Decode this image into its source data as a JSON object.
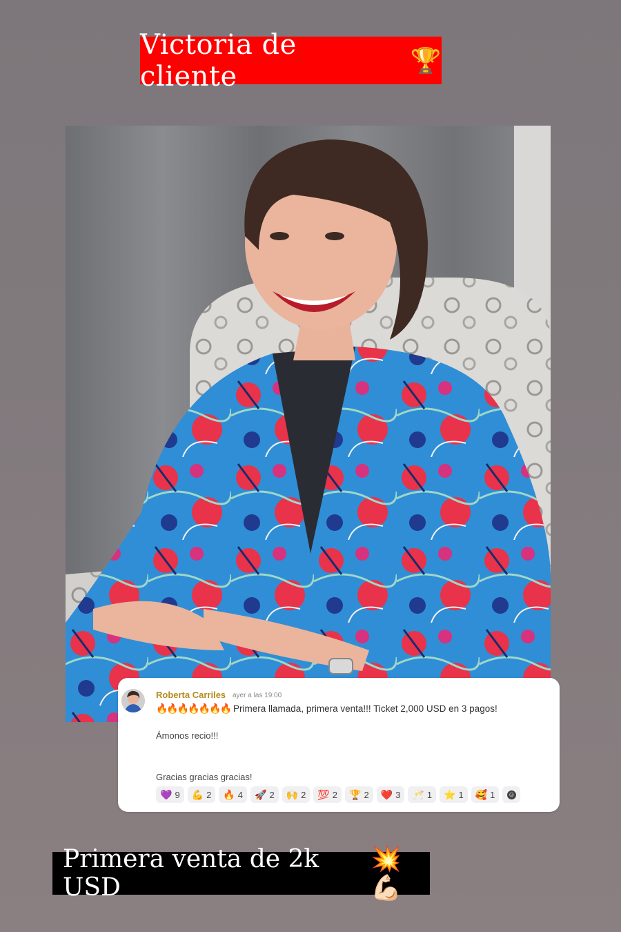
{
  "top_banner": {
    "text": "Victoria de cliente",
    "emoji": "🏆"
  },
  "comment": {
    "author": "Roberta Carriles",
    "timestamp": "ayer a las 19:00",
    "fires": "🔥🔥🔥🔥🔥🔥🔥",
    "line1": "Primera llamada, primera venta!!! Ticket 2,000 USD en 3 pagos!",
    "line2": "Ámonos recio!!!",
    "line3": "Gracias gracias gracias!",
    "reactions": [
      {
        "emoji": "💜",
        "count": "9"
      },
      {
        "emoji": "💪",
        "count": "2"
      },
      {
        "emoji": "🔥",
        "count": "4"
      },
      {
        "emoji": "🚀",
        "count": "2"
      },
      {
        "emoji": "🙌",
        "count": "2"
      },
      {
        "emoji": "💯",
        "count": "2"
      },
      {
        "emoji": "🏆",
        "count": "2"
      },
      {
        "emoji": "❤️",
        "count": "3"
      },
      {
        "emoji": "🥂",
        "count": "1"
      },
      {
        "emoji": "⭐",
        "count": "1"
      },
      {
        "emoji": "🥰",
        "count": "1"
      }
    ]
  },
  "bottom_banner": {
    "text": "Primera venta de 2k USD",
    "emoji": "💥💪🏻"
  }
}
